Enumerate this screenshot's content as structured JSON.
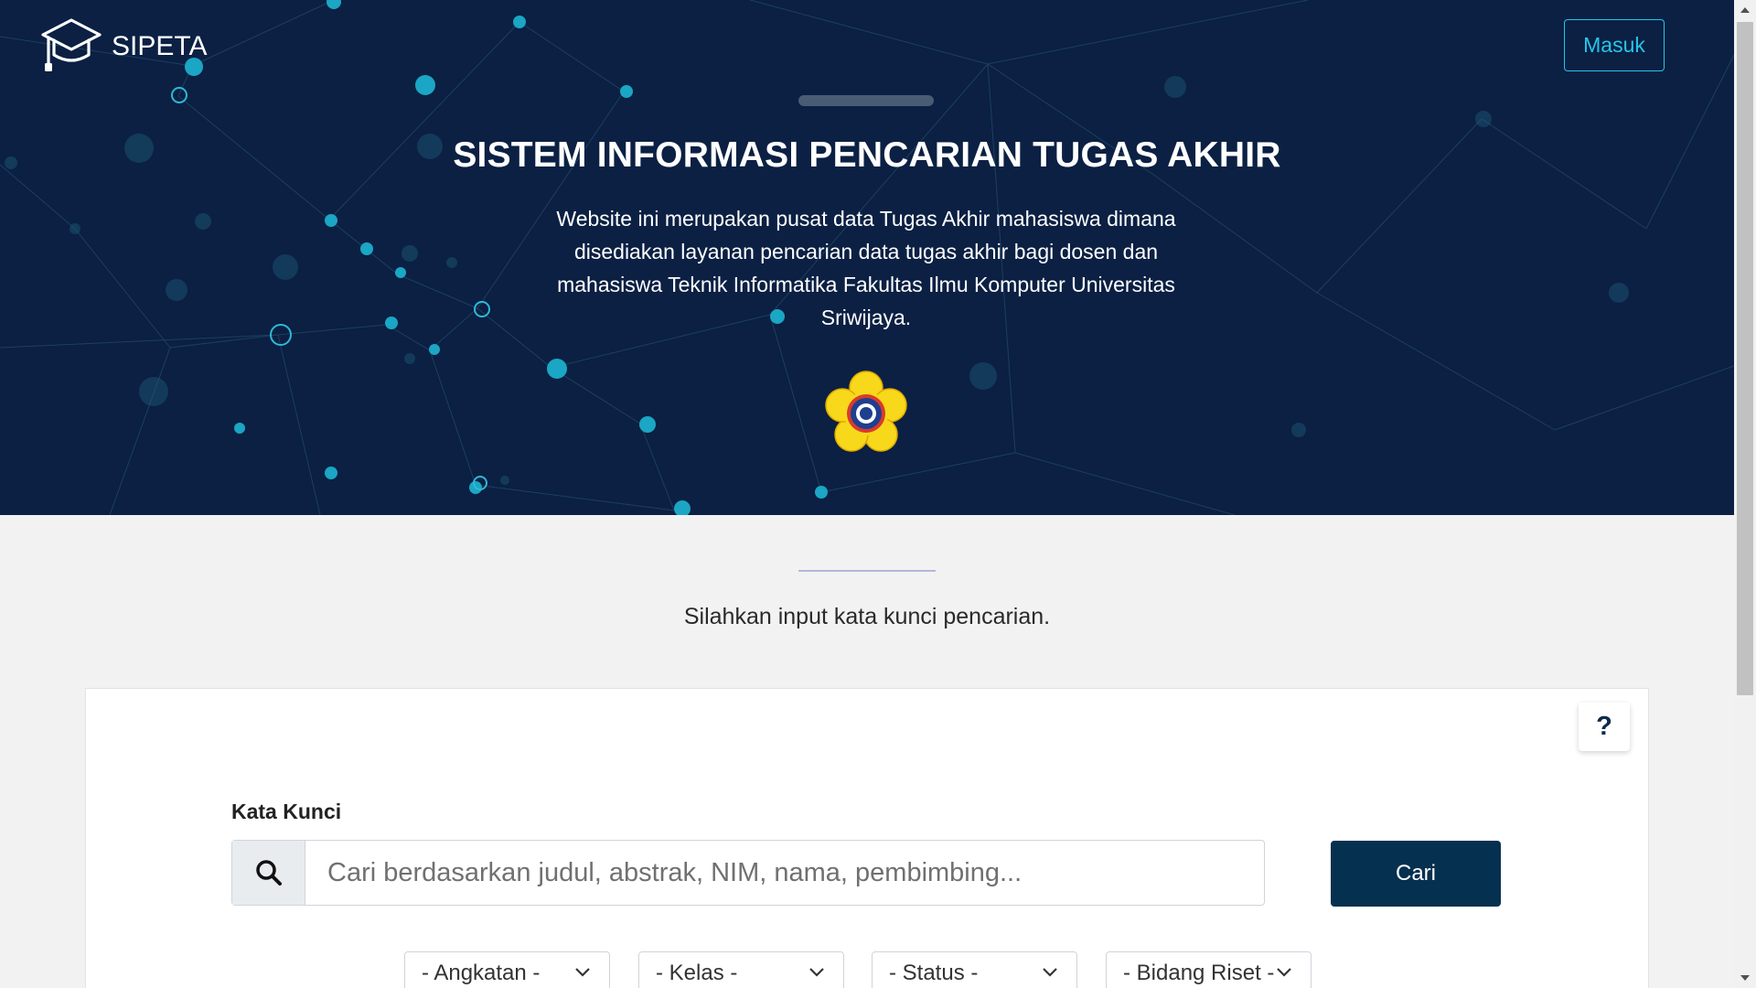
{
  "header": {
    "brand": "SIPETA",
    "login_label": "Masuk",
    "brand_icon": "graduation-cap-icon"
  },
  "hero": {
    "title": "SISTEM INFORMASI PENCARIAN TUGAS AKHIR",
    "description": "Website ini merupakan pusat data Tugas Akhir mahasiswa dimana disediakan layanan pencarian data tugas akhir bagi dosen dan mahasiswa Teknik Informatika Fakultas Ilmu Komputer Universitas Sriwijaya.",
    "emblem": "university-emblem-icon"
  },
  "search": {
    "prompt": "Silahkan input kata kunci pencarian.",
    "help_label": "?",
    "keyword_label": "Kata Kunci",
    "placeholder": "Cari berdasarkan judul, abstrak, NIM, nama, pembimbing...",
    "value": "",
    "submit_label": "Cari",
    "filters": [
      {
        "label": "- Angkatan -"
      },
      {
        "label": "- Kelas -"
      },
      {
        "label": "- Status -"
      },
      {
        "label": "- Bidang Riset -"
      }
    ]
  },
  "colors": {
    "hero_bg": "#0b2043",
    "accent": "#26c6ea",
    "button_primary": "#06304f",
    "emblem_yellow": "#f7d81a"
  }
}
